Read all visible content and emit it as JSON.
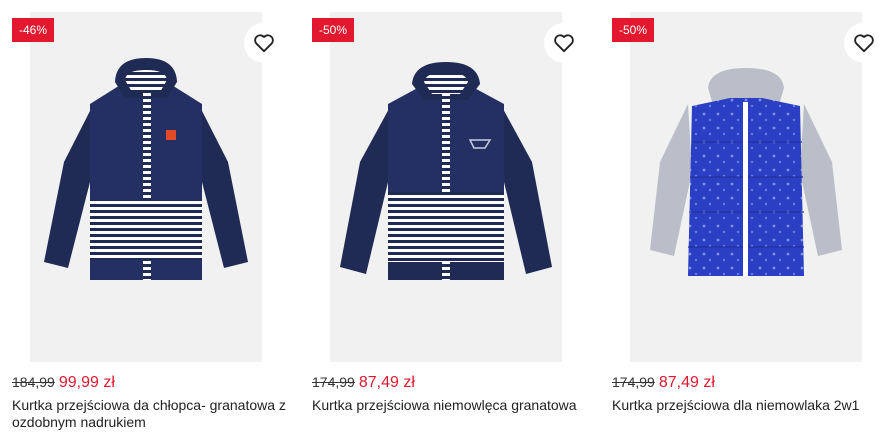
{
  "products": [
    {
      "discount": "-46%",
      "old_price": "184,99",
      "new_price": "99,99 zł",
      "name": "Kurtka przejściowa da chłopca- granatowa z ozdobnym nadrukiem",
      "favorite_icon": "heart-outline-icon"
    },
    {
      "discount": "-50%",
      "old_price": "174,99",
      "new_price": "87,49 zł",
      "name": "Kurtka przejściowa niemowlęca granatowa",
      "favorite_icon": "heart-outline-icon"
    },
    {
      "discount": "-50%",
      "old_price": "174,99",
      "new_price": "87,49 zł",
      "name": "Kurtka przejściowa dla niemowlaka 2w1",
      "favorite_icon": "heart-outline-icon"
    }
  ],
  "colors": {
    "accent": "#e2182f",
    "navy": "#1f2a55",
    "royal": "#2b3fc4",
    "grey": "#b9bec8"
  }
}
